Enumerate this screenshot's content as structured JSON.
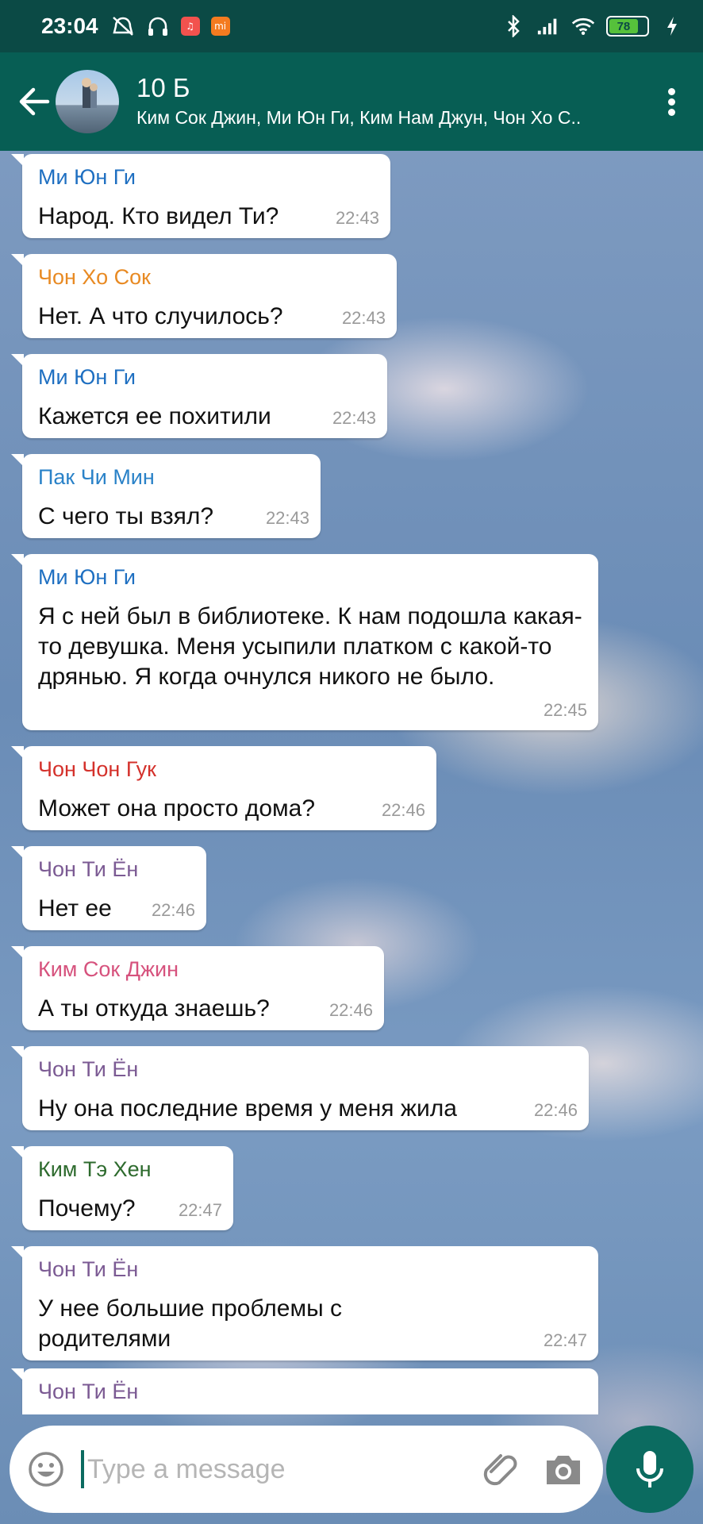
{
  "status_bar": {
    "time": "23:04",
    "battery": "78"
  },
  "header": {
    "title": "10 Б",
    "members": "Ким Сок Джин, Ми Юн Ги, Ким Нам Джун, Чон Хо С.."
  },
  "messages": [
    {
      "sender": "Ми Юн Ги",
      "color": "#1e6fc1",
      "text": "Народ. Кто видел Ти?",
      "time": "22:43"
    },
    {
      "sender": "Чон Хо Сок",
      "color": "#e88a23",
      "text": "Нет. А что случилось?",
      "time": "22:43"
    },
    {
      "sender": "Ми Юн Ги",
      "color": "#1e6fc1",
      "text": "Кажется ее похитили",
      "time": "22:43"
    },
    {
      "sender": "Пак Чи Мин",
      "color": "#2a82c8",
      "text": "С чего ты взял?",
      "time": "22:43"
    },
    {
      "sender": "Ми Юн Ги",
      "color": "#1e6fc1",
      "text": "Я с ней был в библиотеке. К нам подошла какая-то девушка. Меня усыпили платком с какой-то дрянью. Я когда очнулся никого не было.",
      "time": "22:45"
    },
    {
      "sender": "Чон Чон Гук",
      "color": "#d4312b",
      "text": "Может она просто дома?",
      "time": "22:46"
    },
    {
      "sender": "Чон Ти Ён",
      "color": "#7b5a93",
      "text": "Нет ее",
      "time": "22:46"
    },
    {
      "sender": "Ким Сок Джин",
      "color": "#d6527d",
      "text": "А ты откуда знаешь?",
      "time": "22:46"
    },
    {
      "sender": "Чон Ти Ён",
      "color": "#7b5a93",
      "text": "Ну она последние время у меня жила",
      "time": "22:46"
    },
    {
      "sender": "Ким Тэ Хен",
      "color": "#2e6b2e",
      "text": "Почему?",
      "time": "22:47"
    },
    {
      "sender": "Чон Ти Ён",
      "color": "#7b5a93",
      "text": "У нее большие проблемы с родителями",
      "time": "22:47"
    },
    {
      "sender": "Чон Ти Ён",
      "color": "#7b5a93",
      "text": "",
      "time": ""
    }
  ],
  "composer": {
    "placeholder": "Type a message"
  },
  "icons": [
    "arrow-left-icon",
    "more-vert-icon",
    "emoji-icon",
    "paperclip-icon",
    "camera-icon",
    "mic-icon",
    "bluetooth-icon",
    "signal-icon",
    "wifi-icon",
    "battery-icon",
    "charging-icon",
    "alarm-off-icon",
    "headphones-icon",
    "music-app-icon",
    "mi-app-icon"
  ]
}
